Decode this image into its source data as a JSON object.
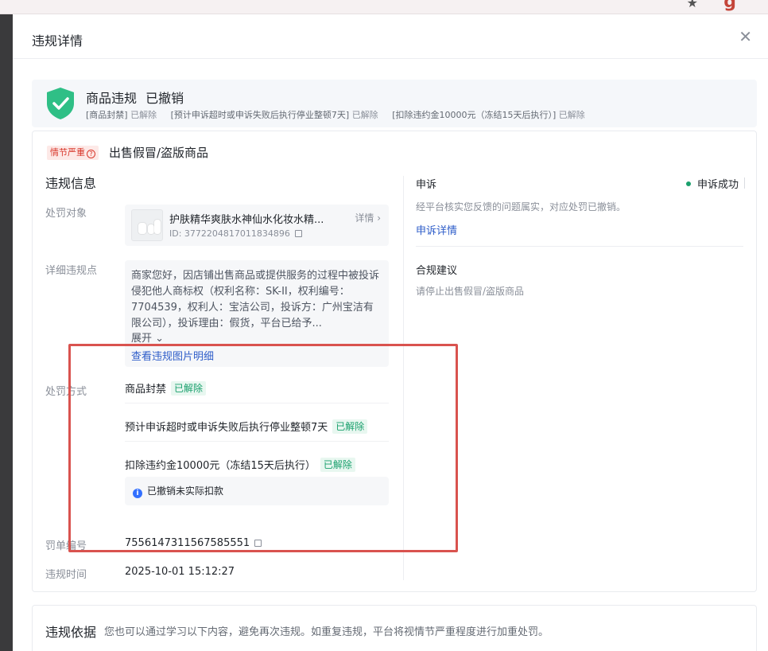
{
  "modal": {
    "title": "违规详情"
  },
  "banner": {
    "title": "商品违规",
    "status": "已撤销",
    "items": [
      {
        "name": "[商品封禁]",
        "state": "已解除"
      },
      {
        "name": "[预计申诉超时或申诉失败后执行停业整顿7天]",
        "state": "已解除"
      },
      {
        "name": "[扣除违约金10000元（冻结15天后执行）]",
        "state": "已解除"
      }
    ]
  },
  "violation": {
    "severity": "情节严重",
    "category": "出售假冒/盗版商品",
    "section_title": "违规信息",
    "labels": {
      "target": "处罚对象",
      "detail": "详细违规点",
      "method": "处罚方式",
      "ticket": "罚单编号",
      "time": "违规时间"
    },
    "product": {
      "name": "护肤精华爽肤水神仙水化妆水精...",
      "id_text": "ID: 3772204817011834896",
      "detail_link": "详情"
    },
    "description": "商家您好，因店铺出售商品或提供服务的过程中被投诉侵犯他人商标权（权利名称：SK-II，权利编号：7704539，权利人：宝洁公司，投诉方：广州宝洁有限公司），投诉理由：假货，平台已给予...",
    "expand": "展开",
    "view_images": "查看违规图片明细",
    "penalties": [
      {
        "text": "商品封禁",
        "state": "已解除"
      },
      {
        "text": "预计申诉超时或申诉失败后执行停业整顿7天",
        "state": "已解除"
      },
      {
        "text": "扣除违约金10000元（冻结15天后执行）",
        "state": "已解除"
      }
    ],
    "note": "已撤销未实际扣款",
    "ticket": "7556147311567585551",
    "time": "2025-10-01 15:12:27"
  },
  "appeal": {
    "title": "申诉",
    "status": "申诉成功",
    "text": "经平台核实您反馈的问题属实，对应处罚已撤销。",
    "link": "申诉详情"
  },
  "advice": {
    "title": "合规建议",
    "text": "请停止出售假冒/盗版商品"
  },
  "basis": {
    "title": "违规依据",
    "text": "您也可以通过学习以下内容，避免再次违规。如重复违规，平台将视情节严重程度进行加重处罚。"
  },
  "colors": {
    "accent": "#2e5dc9",
    "success": "#1aa06d",
    "danger": "#d8372b",
    "annotation": "#d9534f"
  }
}
